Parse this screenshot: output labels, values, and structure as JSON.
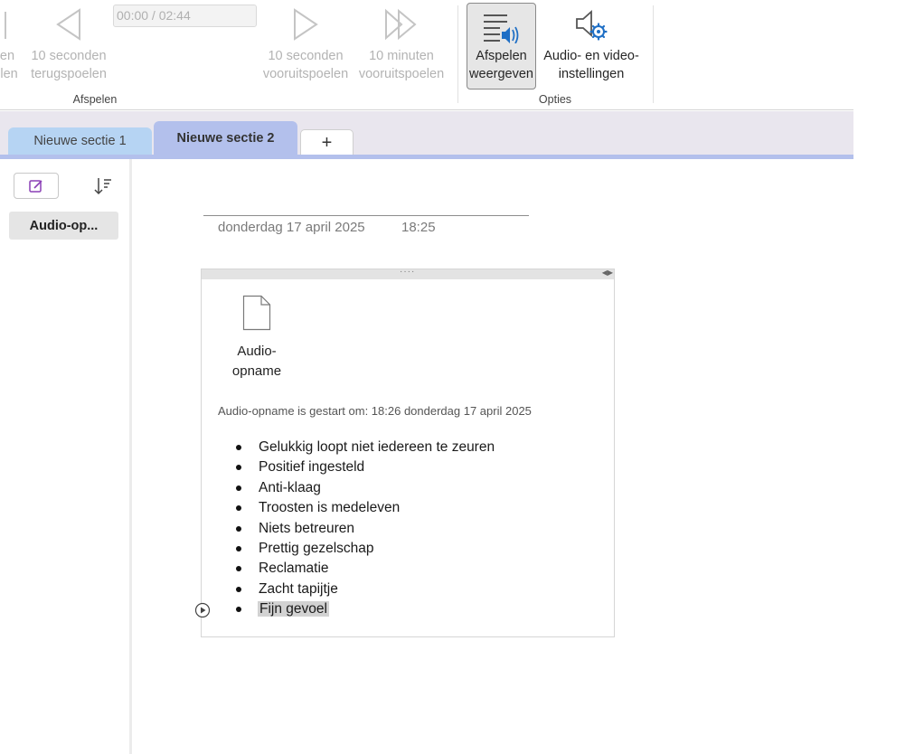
{
  "ribbon": {
    "time_display": "00:00 / 02:44",
    "buttons": [
      {
        "id": "cut-left",
        "label_line1": "ten",
        "label_line2": "elen"
      },
      {
        "id": "rewind-10s",
        "label_line1": "10 seconden",
        "label_line2": "terugspoelen"
      },
      {
        "id": "forward-10s",
        "label_line1": "10 seconden",
        "label_line2": "vooruitspoelen"
      },
      {
        "id": "forward-10m",
        "label_line1": "10 minuten",
        "label_line2": "vooruitspoelen"
      },
      {
        "id": "show-playback",
        "label_line1": "Afspelen",
        "label_line2": "weergeven"
      },
      {
        "id": "av-settings",
        "label_line1": "Audio- en video-",
        "label_line2": "instellingen"
      }
    ],
    "groups": {
      "playback": "Afspelen",
      "options": "Opties"
    }
  },
  "tabs": {
    "items": [
      {
        "label": "Nieuwe sectie 1"
      },
      {
        "label": "Nieuwe sectie 2"
      }
    ],
    "add_label": "+"
  },
  "pagelist": {
    "items": [
      {
        "label": "Audio-op..."
      }
    ]
  },
  "page": {
    "date": "donderdag 17 april 2025",
    "time": "18:25",
    "note": {
      "file_label": "Audio-opname",
      "recording_info": "Audio-opname is gestart om: 18:26 donderdag 17 april 2025",
      "bullets": [
        "Gelukkig loopt niet iedereen te zeuren",
        "Positief ingesteld",
        "Anti-klaag",
        "Troosten is medeleven",
        "Niets betreuren",
        "Prettig gezelschap",
        "Reclamatie",
        "Zacht tapijtje",
        "Fijn gevoel"
      ]
    }
  },
  "colors": {
    "tab_section1": "#b6d4f3",
    "tab_section2": "#b3c0ec",
    "tabbar_bg": "#e9e6ee",
    "accent_strip": "#b3c0ec",
    "icon_blue": "#1f6fc5",
    "newpage_purple": "#8a3fb5"
  }
}
